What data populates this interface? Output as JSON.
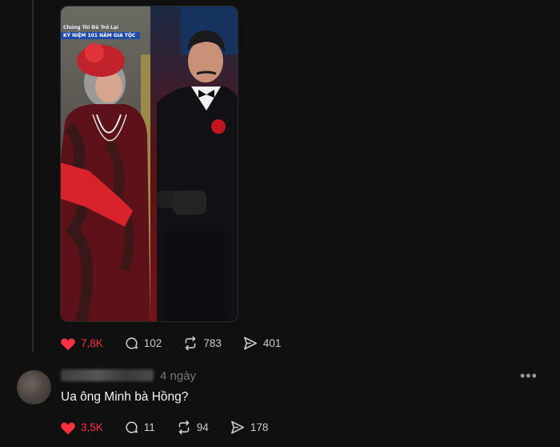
{
  "post": {
    "image_banner_line1": "Chúng Tôi Đã Trở Lại",
    "image_banner_line2": "KỶ NIỆM 101 NĂM GIA TỘC",
    "likes": "7,8K",
    "comments": "102",
    "reposts": "783",
    "shares": "401"
  },
  "reply": {
    "time": "4 ngày",
    "text": "Ua ông Minh bà Hồng?",
    "more": "•••",
    "likes": "3,5K",
    "comments": "11",
    "reposts": "94",
    "shares": "178"
  },
  "colors": {
    "background": "#101010",
    "like": "#ff3040",
    "text": "#f3f5f7",
    "muted": "#777777"
  }
}
